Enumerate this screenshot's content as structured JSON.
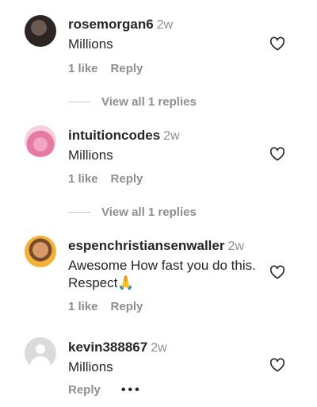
{
  "comments": [
    {
      "username": "rosemorgan6",
      "time": "2w",
      "text": "Millions",
      "likes": "1 like",
      "reply": "Reply",
      "view_replies": "View all 1 replies"
    },
    {
      "username": "intuitioncodes",
      "time": "2w",
      "text": "Millions",
      "likes": "1 like",
      "reply": "Reply",
      "view_replies": "View all 1 replies"
    },
    {
      "username": "espenchristiansenwaller",
      "time": "2w",
      "text": "Awesome How fast you do this. Respect🙏",
      "likes": "1 like",
      "reply": "Reply"
    },
    {
      "username": "kevin388867",
      "time": "2w",
      "text": "Millions",
      "reply": "Reply",
      "more": "•••"
    }
  ]
}
